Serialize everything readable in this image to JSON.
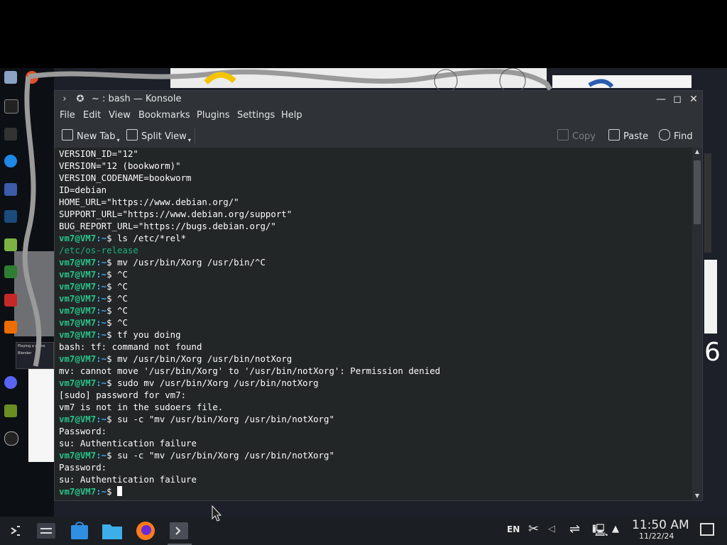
{
  "window": {
    "title": "~ : bash — Konsole",
    "minimize": "—",
    "maximize": "◻",
    "close": "✕"
  },
  "menu": [
    "File",
    "Edit",
    "View",
    "Bookmarks",
    "Plugins",
    "Settings",
    "Help"
  ],
  "toolbar": {
    "new_tab": "New Tab",
    "split_view": "Split View",
    "copy": "Copy",
    "paste": "Paste",
    "find": "Find"
  },
  "terminal": {
    "user_host": "vm7@VM7",
    "path": ":~",
    "dollar": "$",
    "lines": [
      {
        "type": "out",
        "text": "VERSION_ID=\"12\""
      },
      {
        "type": "out",
        "text": "VERSION=\"12 (bookworm)\""
      },
      {
        "type": "out",
        "text": "VERSION_CODENAME=bookworm"
      },
      {
        "type": "out",
        "text": "ID=debian"
      },
      {
        "type": "out",
        "text": "HOME_URL=\"https://www.debian.org/\""
      },
      {
        "type": "out",
        "text": "SUPPORT_URL=\"https://www.debian.org/support\""
      },
      {
        "type": "out",
        "text": "BUG_REPORT_URL=\"https://bugs.debian.org/\""
      },
      {
        "type": "cmd",
        "text": " ls /etc/*rel*"
      },
      {
        "type": "green",
        "text": "/etc/os-release"
      },
      {
        "type": "cmd",
        "text": " mv /usr/bin/Xorg /usr/bin/^C"
      },
      {
        "type": "cmd",
        "text": " ^C"
      },
      {
        "type": "cmd",
        "text": " ^C"
      },
      {
        "type": "cmd",
        "text": " ^C"
      },
      {
        "type": "cmd",
        "text": " ^C"
      },
      {
        "type": "cmd",
        "text": " ^C"
      },
      {
        "type": "cmd",
        "text": " tf you doing"
      },
      {
        "type": "out",
        "text": "bash: tf: command not found"
      },
      {
        "type": "cmd",
        "text": " mv /usr/bin/Xorg /usr/bin/notXorg"
      },
      {
        "type": "out",
        "text": "mv: cannot move '/usr/bin/Xorg' to '/usr/bin/notXorg': Permission denied"
      },
      {
        "type": "cmd",
        "text": " sudo mv /usr/bin/Xorg /usr/bin/notXorg"
      },
      {
        "type": "out",
        "text": "[sudo] password for vm7:"
      },
      {
        "type": "out",
        "text": "vm7 is not in the sudoers file."
      },
      {
        "type": "cmd",
        "text": " su -c \"mv /usr/bin/Xorg /usr/bin/notXorg\""
      },
      {
        "type": "out",
        "text": "Password:"
      },
      {
        "type": "out",
        "text": "su: Authentication failure"
      },
      {
        "type": "cmd",
        "text": " su -c \"mv /usr/bin/Xorg /usr/bin/notXorg\""
      },
      {
        "type": "out",
        "text": "Password:"
      },
      {
        "type": "out",
        "text": "su: Authentication failure"
      },
      {
        "type": "cmd",
        "text": " "
      }
    ]
  },
  "taskbar": {
    "language": "EN",
    "time": "11:50 AM",
    "date": "11/22/24"
  },
  "desktop": {
    "number": "6",
    "card_title": "Playing a game",
    "card_sub": "Blender"
  },
  "colors": {
    "prompt": "#27c38a",
    "terminal_bg": "#232627",
    "window_chrome": "#2f3337"
  }
}
